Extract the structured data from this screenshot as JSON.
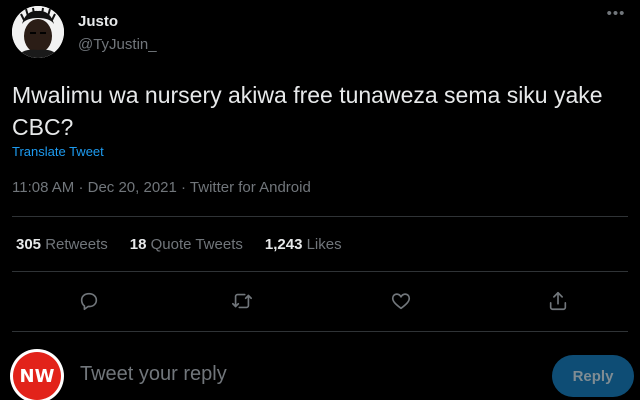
{
  "author": {
    "name": "Justo",
    "handle": "@TyJustin_"
  },
  "more_icon": "more-horizontal-icon",
  "tweet": {
    "text": "Mwalimu wa nursery akiwa free tunaweza sema siku yake CBC?",
    "translate_label": "Translate Tweet",
    "time": "11:08 AM",
    "date": "Dec 20, 2021",
    "source": "Twitter for Android",
    "separator": "·"
  },
  "stats": [
    {
      "count": "305",
      "label": "Retweets"
    },
    {
      "count": "18",
      "label": "Quote Tweets"
    },
    {
      "count": "1,243",
      "label": "Likes"
    }
  ],
  "actions": {
    "reply_icon": "reply-icon",
    "retweet_icon": "retweet-icon",
    "like_icon": "heart-icon",
    "share_icon": "share-icon"
  },
  "reply_box": {
    "avatar_text": "NW",
    "placeholder": "Tweet your reply",
    "button_label": "Reply"
  },
  "colors": {
    "background": "#000000",
    "text": "#e7e9ea",
    "muted": "#71767b",
    "accent": "#1d9bf0",
    "divider": "#2f3336",
    "reply_button": "#0e4d75",
    "nw_red": "#e2231a"
  }
}
